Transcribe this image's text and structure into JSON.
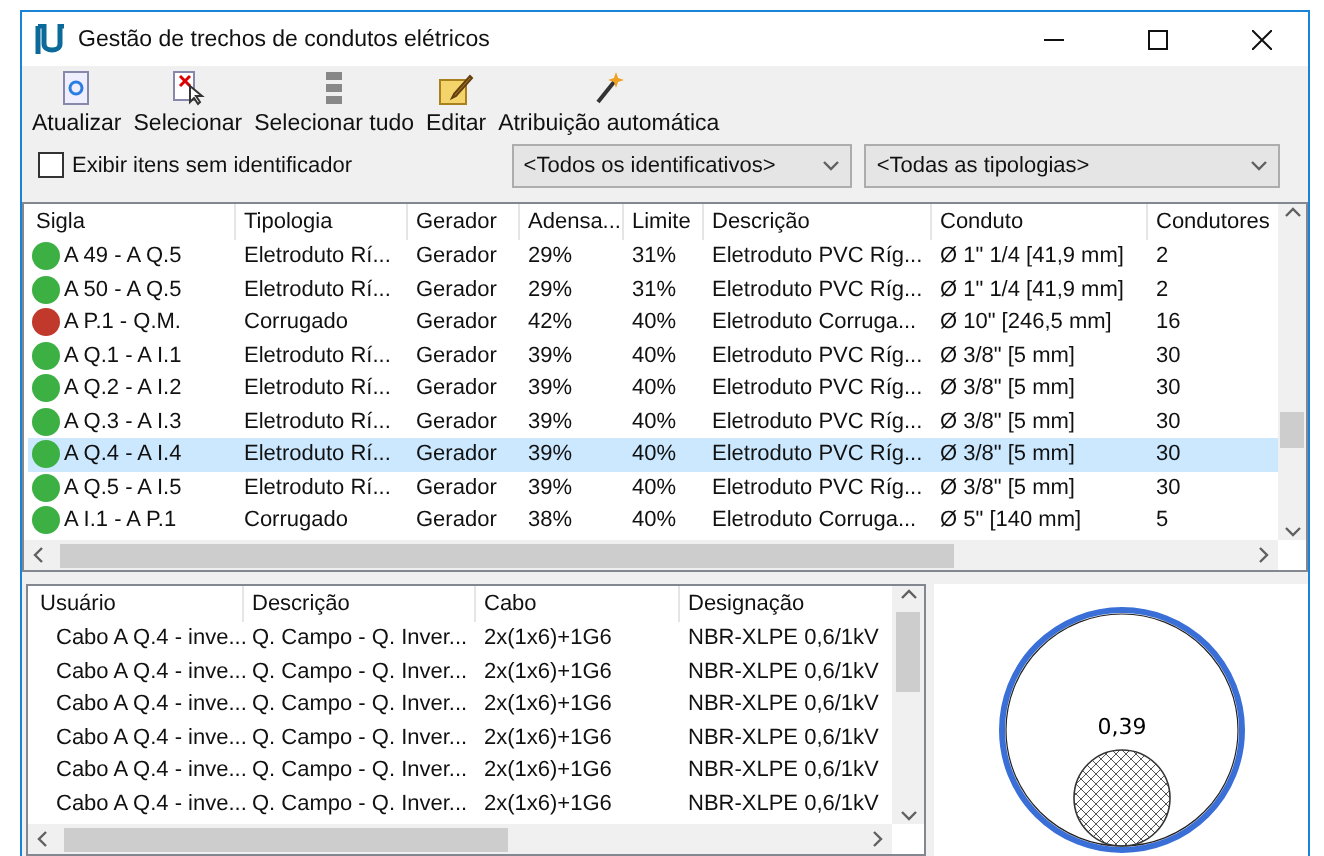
{
  "window": {
    "title": "Gestão de trechos de condutos elétricos"
  },
  "toolbar": [
    "Atualizar",
    "Selecionar",
    "Selecionar tudo",
    "Editar",
    "Atribuição automática"
  ],
  "filters": {
    "show_unidentified": {
      "label": "Exibir itens sem identificador",
      "checked": false
    },
    "identifier": "<Todos os identificativos>",
    "typology": "<Todas as tipologias>"
  },
  "conduits": {
    "columns": [
      "Sigla",
      "Tipologia",
      "Gerador",
      "Adensa...",
      "Limite",
      "Descrição",
      "Conduto",
      "Condutores"
    ],
    "rows": [
      {
        "color": "#3cb043",
        "selected": false,
        "cells": [
          "A 49 - A Q.5",
          "Eletroduto Rí...",
          "Gerador",
          "29%",
          "31%",
          "Eletroduto PVC Ríg...",
          "Ø 1\" 1/4 [41,9 mm]",
          "2"
        ]
      },
      {
        "color": "#3cb043",
        "selected": false,
        "cells": [
          "A 50 - A Q.5",
          "Eletroduto Rí...",
          "Gerador",
          "29%",
          "31%",
          "Eletroduto PVC Ríg...",
          "Ø 1\" 1/4 [41,9 mm]",
          "2"
        ]
      },
      {
        "color": "#c0392b",
        "selected": false,
        "cells": [
          "A P.1 - Q.M.",
          "Corrugado",
          "Gerador",
          "42%",
          "40%",
          "Eletroduto Corruga...",
          "Ø 10\" [246,5 mm]",
          "16"
        ]
      },
      {
        "color": "#3cb043",
        "selected": false,
        "cells": [
          "A Q.1 - A I.1",
          "Eletroduto Rí...",
          "Gerador",
          "39%",
          "40%",
          "Eletroduto PVC Ríg...",
          "Ø 3/8\" [5 mm]",
          "30"
        ]
      },
      {
        "color": "#3cb043",
        "selected": false,
        "cells": [
          "A Q.2 - A I.2",
          "Eletroduto Rí...",
          "Gerador",
          "39%",
          "40%",
          "Eletroduto PVC Ríg...",
          "Ø 3/8\" [5 mm]",
          "30"
        ]
      },
      {
        "color": "#3cb043",
        "selected": false,
        "cells": [
          "A Q.3 - A I.3",
          "Eletroduto Rí...",
          "Gerador",
          "39%",
          "40%",
          "Eletroduto PVC Ríg...",
          "Ø 3/8\" [5 mm]",
          "30"
        ]
      },
      {
        "color": "#3cb043",
        "selected": true,
        "cells": [
          "A Q.4 - A I.4",
          "Eletroduto Rí...",
          "Gerador",
          "39%",
          "40%",
          "Eletroduto PVC Ríg...",
          "Ø 3/8\" [5 mm]",
          "30"
        ]
      },
      {
        "color": "#3cb043",
        "selected": false,
        "cells": [
          "A Q.5 - A I.5",
          "Eletroduto Rí...",
          "Gerador",
          "39%",
          "40%",
          "Eletroduto PVC Ríg...",
          "Ø 3/8\" [5 mm]",
          "30"
        ]
      },
      {
        "color": "#3cb043",
        "selected": false,
        "cells": [
          "A I.1 - A P.1",
          "Corrugado",
          "Gerador",
          "38%",
          "40%",
          "Eletroduto Corruga...",
          "Ø 5\" [140 mm]",
          "5"
        ]
      }
    ]
  },
  "cables": {
    "columns": [
      "Usuário",
      "Descrição",
      "Cabo",
      "Designação"
    ],
    "rows": [
      [
        "Cabo A Q.4 - inve...",
        "Q. Campo - Q. Inver...",
        "2x(1x6)+1G6",
        "NBR-XLPE 0,6/1kV"
      ],
      [
        "Cabo A Q.4 - inve...",
        "Q. Campo - Q. Inver...",
        "2x(1x6)+1G6",
        "NBR-XLPE 0,6/1kV"
      ],
      [
        "Cabo A Q.4 - inve...",
        "Q. Campo - Q. Inver...",
        "2x(1x6)+1G6",
        "NBR-XLPE 0,6/1kV"
      ],
      [
        "Cabo A Q.4 - inve...",
        "Q. Campo - Q. Inver...",
        "2x(1x6)+1G6",
        "NBR-XLPE 0,6/1kV"
      ],
      [
        "Cabo A Q.4 - inve...",
        "Q. Campo - Q. Inver...",
        "2x(1x6)+1G6",
        "NBR-XLPE 0,6/1kV"
      ],
      [
        "Cabo A Q.4 - inve...",
        "Q. Campo - Q. Inver...",
        "2x(1x6)+1G6",
        "NBR-XLPE 0,6/1kV"
      ]
    ]
  },
  "section_preview": {
    "fill_label": "0,39"
  }
}
